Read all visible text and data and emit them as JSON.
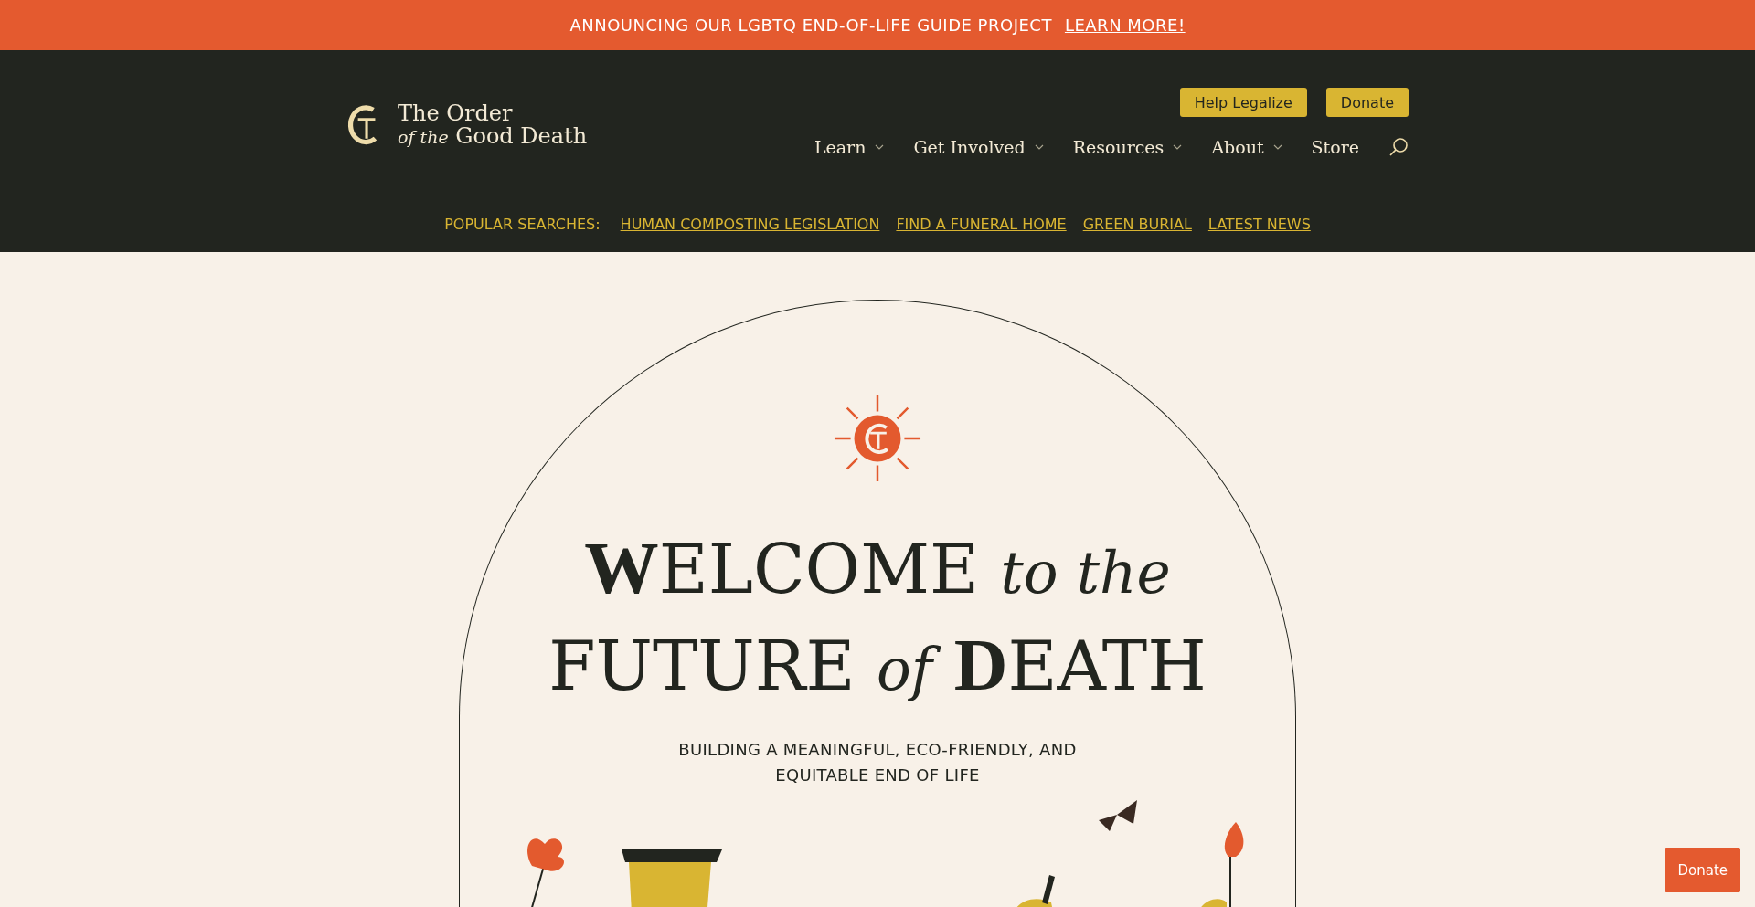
{
  "announcement": {
    "text": "ANNOUNCING OUR LGBTQ END-OF-LIFE GUIDE PROJECT",
    "link": "LEARN MORE!"
  },
  "header": {
    "logo": {
      "line_1": "The Order",
      "line_2_italic": "of the",
      "line_2": "Good Death"
    },
    "buttons": [
      "Help Legalize",
      "Donate"
    ],
    "nav": [
      {
        "label": "Learn",
        "dropdown": true
      },
      {
        "label": "Get Involved",
        "dropdown": true
      },
      {
        "label": "Resources",
        "dropdown": true
      },
      {
        "label": "About",
        "dropdown": true
      },
      {
        "label": "Store",
        "dropdown": false
      }
    ]
  },
  "popular_searches": {
    "label": "POPULAR SEARCHES:",
    "links": [
      "HUMAN COMPOSTING LEGISLATION",
      "FIND A FUNERAL HOME",
      "GREEN BURIAL",
      "LATEST NEWS"
    ]
  },
  "hero": {
    "title_lines": [
      "**W**ELCOME *to the*",
      "FUTURE *of* **D**EATH"
    ],
    "subtitle": "BUILDING A MEANINGFUL, ECO-FRIENDLY, AND EQUITABLE END OF LIFE"
  },
  "floating_button": "Donate"
}
